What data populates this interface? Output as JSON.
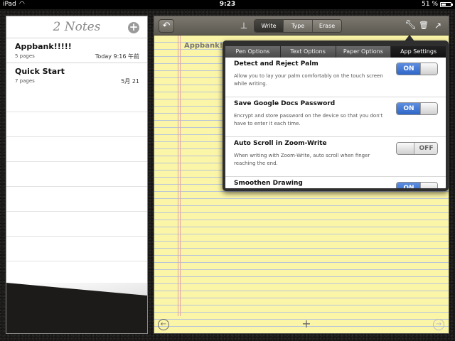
{
  "status_bar": {
    "carrier": "iPad",
    "wifi_icon": "wifi-icon",
    "time": "9:23",
    "battery_percent": "51 %",
    "battery_level": 0.51
  },
  "notes_panel": {
    "title": "2 Notes",
    "add_icon": "plus-circle-icon",
    "notes": [
      {
        "title": "Appbank!!!!!",
        "pages": "5 pages",
        "date": "Today 9:16 午前"
      },
      {
        "title": "Quick Start",
        "pages": "7 pages",
        "date": "5月 21"
      }
    ]
  },
  "toolbar": {
    "undo_icon": "undo-arrow-icon",
    "stamp_icon": "stamp-icon",
    "modes": [
      {
        "label": "Write",
        "active": true
      },
      {
        "label": "Type",
        "active": false
      },
      {
        "label": "Erase",
        "active": false
      }
    ],
    "wrench_icon": "wrench-icon",
    "trash_icon": "trash-icon",
    "share_icon": "share-icon"
  },
  "note": {
    "text": "Appbank!!!!!"
  },
  "bottom_bar": {
    "back_icon": "back-circle-icon",
    "add_page_icon": "plus-icon",
    "forward_icon": "forward-circle-icon"
  },
  "settings_popover": {
    "tabs": [
      {
        "label": "Pen Options",
        "active": false
      },
      {
        "label": "Text Options",
        "active": false
      },
      {
        "label": "Paper Options",
        "active": false
      },
      {
        "label": "App Settings",
        "active": true
      }
    ],
    "settings": [
      {
        "title": "Detect and Reject Palm",
        "description": "Allow you to lay your palm comfortably on the touch screen while writing.",
        "state": "ON"
      },
      {
        "title": "Save Google Docs Password",
        "description": "Encrypt and store password on the device so that you don't have to enter it each time.",
        "state": "ON"
      },
      {
        "title": "Auto Scroll in Zoom-Write",
        "description": "When writing with Zoom-Write, auto scroll when finger reaching the end.",
        "state": "OFF"
      },
      {
        "title": "Smoothen Drawing",
        "description": "",
        "state": "ON"
      }
    ]
  }
}
